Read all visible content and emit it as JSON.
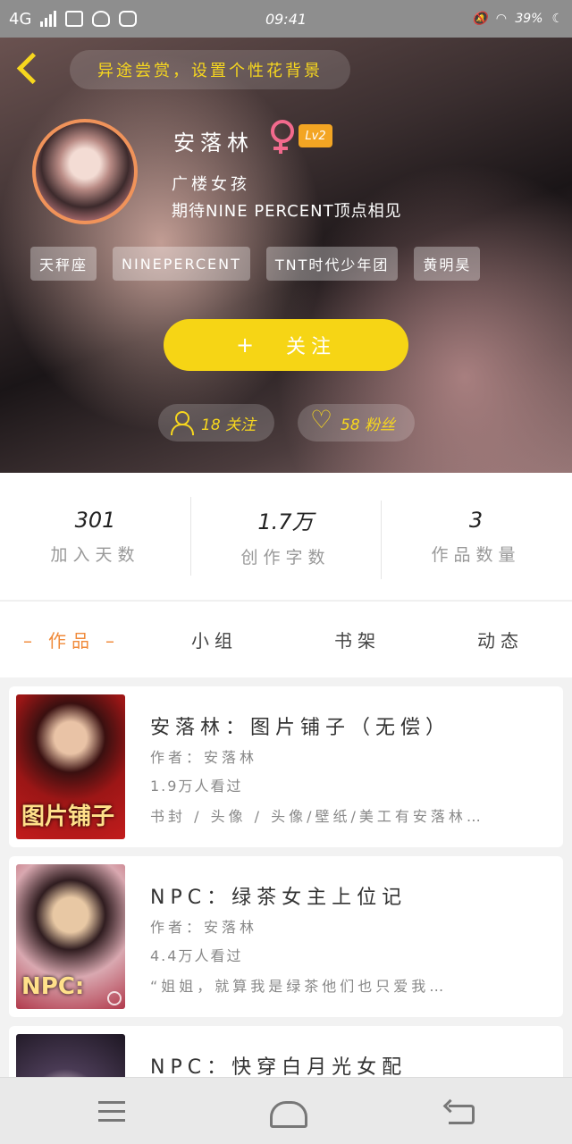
{
  "status_bar": {
    "network": "4G",
    "time": "09:41",
    "battery": "39%"
  },
  "header": {
    "tip": "异途尝赏，设置个性花背景",
    "name": "安落林",
    "level": "Lv2",
    "bio_line1": "广楼女孩",
    "bio_line2": "期待NINE PERCENT顶点相见",
    "tags": [
      "天秤座",
      "NINEPERCENT",
      "TNT时代少年团",
      "黄明昊"
    ],
    "follow_label": "关注",
    "follow_plus": "+",
    "following_count": "18 关注",
    "fans_count": "58 粉丝",
    "accent_color": "#f7d71e"
  },
  "stats": [
    {
      "value": "301",
      "label": "加入天数"
    },
    {
      "value": "1.7万",
      "label": "创作字数"
    },
    {
      "value": "3",
      "label": "作品数量"
    }
  ],
  "tabs": [
    {
      "label": "作品",
      "active": true
    },
    {
      "label": "小组",
      "active": false
    },
    {
      "label": "书架",
      "active": false
    },
    {
      "label": "动态",
      "active": false
    }
  ],
  "works": [
    {
      "title": "安落林：图片铺子（无偿）",
      "author": "作者：安落林",
      "readers": "1.9万人看过",
      "desc": "书封 / 头像 / 头像/壁纸/美工有安落林…",
      "cover_text": "图片铺子"
    },
    {
      "title": "NPC：绿茶女主上位记",
      "author": "作者：安落林",
      "readers": "4.4万人看过",
      "desc": "“姐姐，就算我是绿茶他们也只爱我…",
      "cover_text": "NPC:"
    },
    {
      "title": "NPC：快穿白月光女配",
      "author": "",
      "readers": "",
      "desc": "",
      "cover_text": ""
    }
  ]
}
